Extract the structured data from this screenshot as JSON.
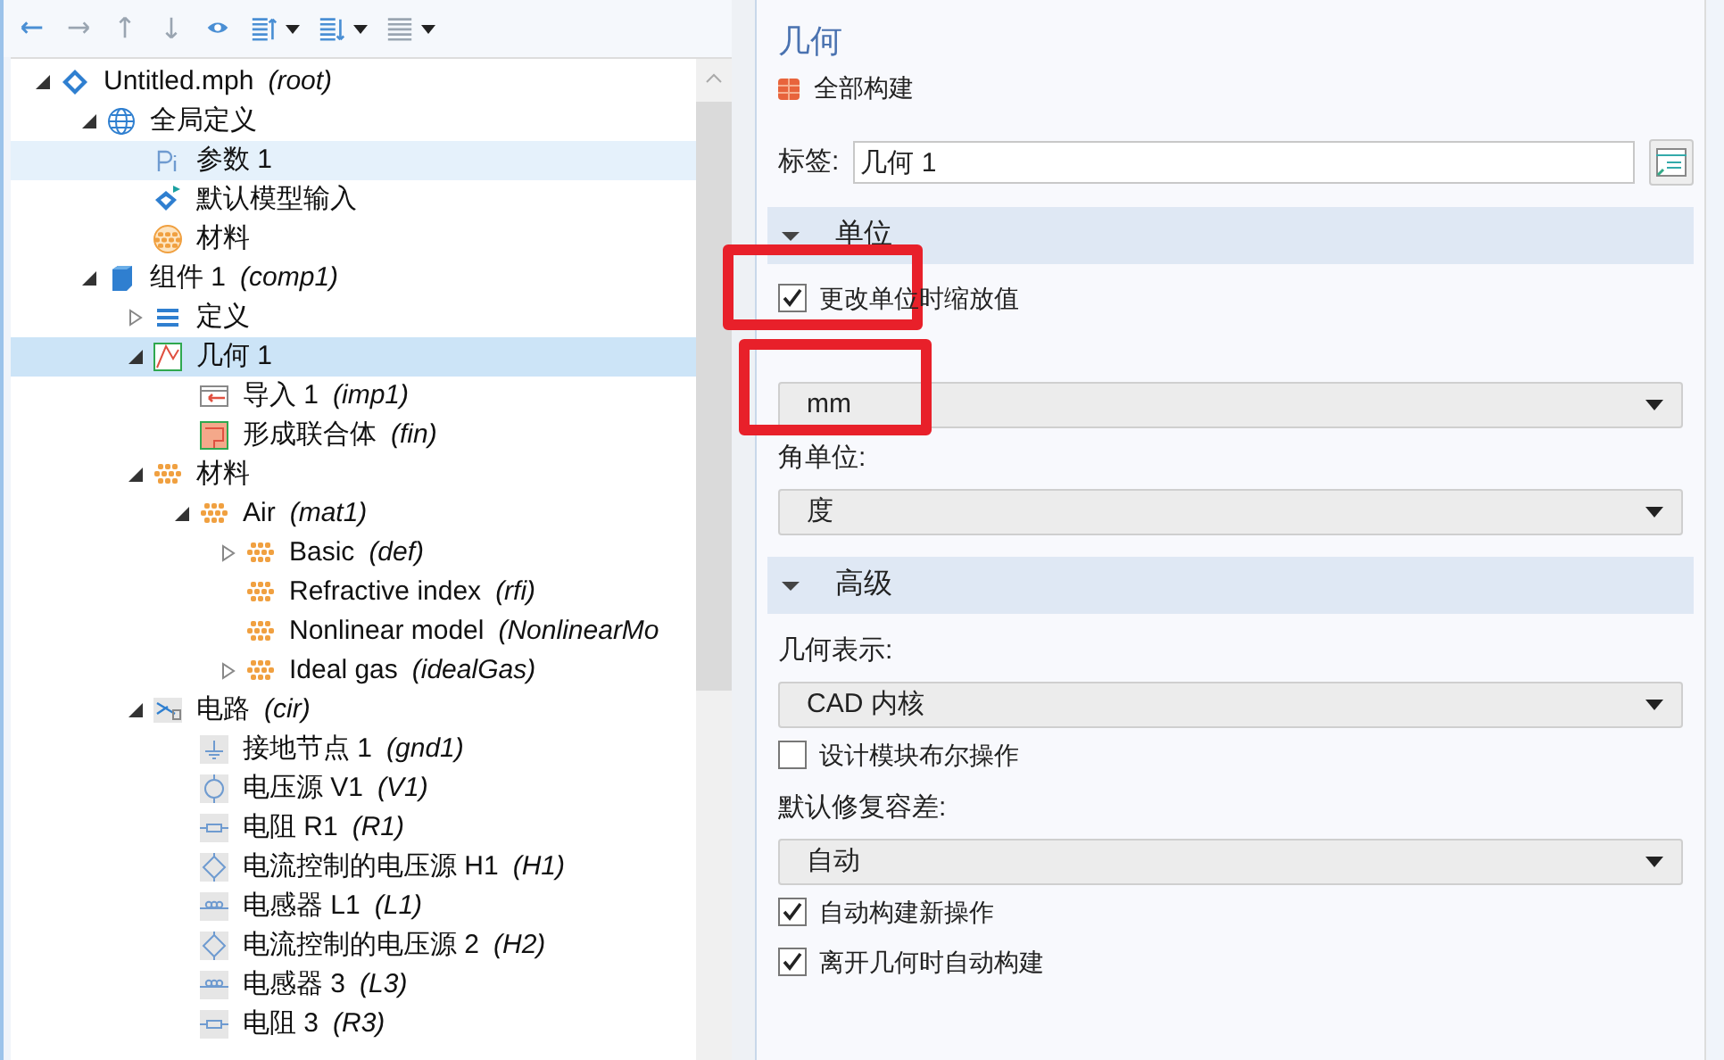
{
  "toolbar": [
    {
      "kind": "back",
      "dropdown": false
    },
    {
      "kind": "forward",
      "dropdown": false
    },
    {
      "kind": "up",
      "dropdown": false
    },
    {
      "kind": "down",
      "dropdown": false
    },
    {
      "kind": "show",
      "dropdown": false
    },
    {
      "kind": "expand",
      "dropdown": true
    },
    {
      "kind": "collapse",
      "dropdown": true
    },
    {
      "kind": "list",
      "dropdown": true
    }
  ],
  "tree": [
    {
      "name": "Untitled.mph",
      "tag": "(root)",
      "kind": "root",
      "expanded": true,
      "selected": false,
      "hovered": false,
      "children": [
        {
          "name": "全局定义",
          "kind": "globe",
          "expanded": true,
          "selected": false,
          "hovered": false,
          "children": [
            {
              "name": "参数 1",
              "kind": "param",
              "selected": false,
              "hovered": true
            },
            {
              "name": "默认模型输入",
              "kind": "model-input",
              "selected": false,
              "hovered": false
            },
            {
              "name": "材料",
              "kind": "material-ball",
              "selected": false,
              "hovered": false
            }
          ]
        },
        {
          "name": "组件 1",
          "tag": "(comp1)",
          "kind": "cube",
          "expanded": true,
          "selected": false,
          "hovered": false,
          "children": [
            {
              "name": "定义",
              "kind": "definitions",
              "expanded": false,
              "selected": false,
              "hovered": false
            },
            {
              "name": "几何 1",
              "kind": "geometry",
              "expanded": true,
              "selected": true,
              "hovered": false,
              "children": [
                {
                  "name": "导入 1",
                  "tag": "(imp1)",
                  "kind": "import",
                  "selected": false,
                  "hovered": false
                },
                {
                  "name": "形成联合体",
                  "tag": "(fin)",
                  "kind": "union",
                  "selected": false,
                  "hovered": false
                }
              ]
            },
            {
              "name": "材料",
              "kind": "material",
              "expanded": true,
              "selected": false,
              "hovered": false,
              "children": [
                {
                  "name": "Air",
                  "tag": "(mat1)",
                  "kind": "material",
                  "expanded": true,
                  "selected": false,
                  "hovered": false,
                  "children": [
                    {
                      "name": "Basic",
                      "tag": "(def)",
                      "kind": "material",
                      "expanded": false,
                      "selected": false,
                      "hovered": false
                    },
                    {
                      "name": "Refractive index",
                      "tag": "(rfi)",
                      "kind": "material",
                      "selected": false,
                      "hovered": false
                    },
                    {
                      "name": "Nonlinear model",
                      "tag": "(NonlinearMo",
                      "kind": "material",
                      "selected": false,
                      "hovered": false
                    },
                    {
                      "name": "Ideal gas",
                      "tag": "(idealGas)",
                      "kind": "material",
                      "expanded": false,
                      "selected": false,
                      "hovered": false
                    }
                  ]
                }
              ]
            },
            {
              "name": "电路",
              "tag": "(cir)",
              "kind": "circuit",
              "expanded": true,
              "selected": false,
              "hovered": false,
              "children": [
                {
                  "name": "接地节点 1",
                  "tag": "(gnd1)",
                  "kind": "ground",
                  "selected": false,
                  "hovered": false
                },
                {
                  "name": "电压源 V1",
                  "tag": "(V1)",
                  "kind": "voltage-source",
                  "selected": false,
                  "hovered": false
                },
                {
                  "name": "电阻 R1",
                  "tag": "(R1)",
                  "kind": "resistor",
                  "selected": false,
                  "hovered": false
                },
                {
                  "name": "电流控制的电压源 H1",
                  "tag": "(H1)",
                  "kind": "controlled-source",
                  "selected": false,
                  "hovered": false
                },
                {
                  "name": "电感器 L1",
                  "tag": "(L1)",
                  "kind": "inductor",
                  "selected": false,
                  "hovered": false
                },
                {
                  "name": "电流控制的电压源 2",
                  "tag": "(H2)",
                  "kind": "controlled-source",
                  "selected": false,
                  "hovered": false
                },
                {
                  "name": "电感器 3",
                  "tag": "(L3)",
                  "kind": "inductor",
                  "selected": false,
                  "hovered": false
                },
                {
                  "name": "电阻 3",
                  "tag": "(R3)",
                  "kind": "resistor",
                  "selected": false,
                  "hovered": false
                }
              ]
            }
          ]
        }
      ]
    }
  ],
  "settings": {
    "title": "几何",
    "build_all": "全部构建",
    "label": {
      "caption": "标签:",
      "value": "几何 1"
    },
    "sections": [
      {
        "title": "单位",
        "expanded": true,
        "items": [
          {
            "kind": "checkbox",
            "text": "更改单位时缩放值",
            "checked": true
          },
          {
            "kind": "select",
            "value": "mm"
          },
          {
            "kind": "caption",
            "text": "角单位:"
          },
          {
            "kind": "select",
            "value": "度"
          }
        ]
      },
      {
        "title": "高级",
        "expanded": true,
        "items": [
          {
            "kind": "caption",
            "text": "几何表示:"
          },
          {
            "kind": "select",
            "value": "CAD 内核"
          },
          {
            "kind": "checkbox",
            "text": "设计模块布尔操作",
            "checked": false
          },
          {
            "kind": "caption",
            "text": "默认修复容差:"
          },
          {
            "kind": "select",
            "value": "自动"
          },
          {
            "kind": "checkbox",
            "text": "自动构建新操作",
            "checked": true
          },
          {
            "kind": "checkbox",
            "text": "离开几何时自动构建",
            "checked": true
          }
        ]
      }
    ]
  }
}
